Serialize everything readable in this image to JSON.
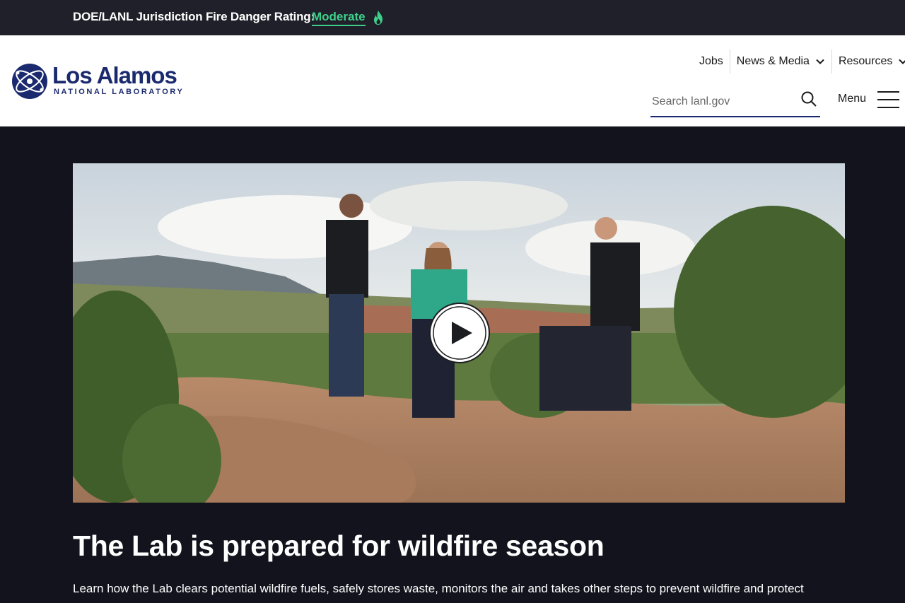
{
  "fire_banner": {
    "label": "DOE/LANL Jurisdiction Fire Danger Rating:",
    "rating": "Moderate",
    "rating_color": "#3ed08b"
  },
  "logo": {
    "name": "Los Alamos",
    "subtitle": "NATIONAL LABORATORY",
    "brand_color": "#1b2a6e"
  },
  "utility_nav": {
    "items": [
      {
        "label": "Jobs",
        "has_dropdown": false
      },
      {
        "label": "News & Media",
        "has_dropdown": true
      },
      {
        "label": "Resources",
        "has_dropdown": true
      }
    ]
  },
  "search": {
    "placeholder": "Search lanl.gov",
    "value": "",
    "icon": "search-icon"
  },
  "menu": {
    "label": "Menu",
    "icon": "hamburger-icon"
  },
  "hero": {
    "video_icon": "play-icon",
    "headline": "The Lab is prepared for wildfire season",
    "lede": "Learn how the Lab clears potential wildfire fuels, safely stores waste, monitors the air and takes other steps to prevent wildfire and protect"
  },
  "colors": {
    "page_background": "#12131d",
    "banner_background": "#1f2029"
  }
}
